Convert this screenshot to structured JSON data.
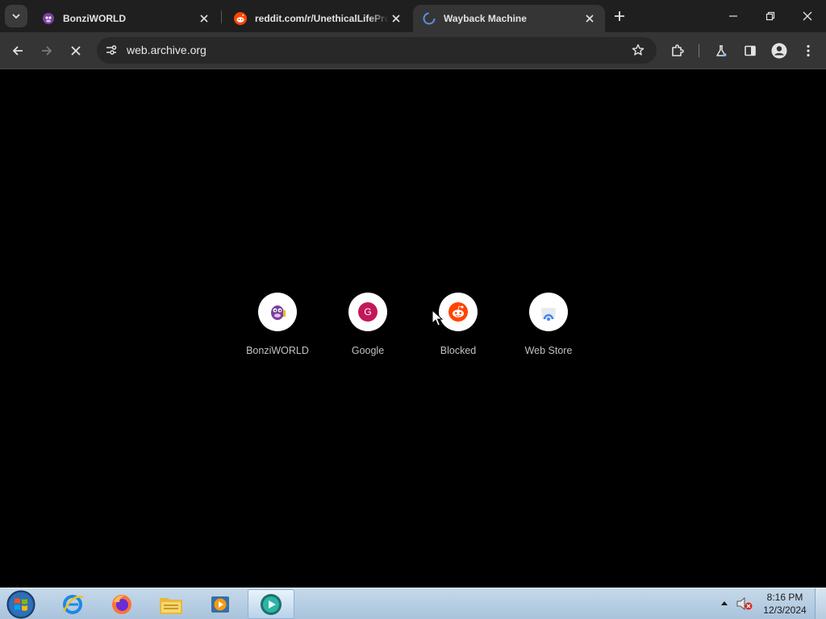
{
  "browser": {
    "tabs": [
      {
        "title": "BonziWORLD",
        "favicon": "bonzi-icon",
        "active": false
      },
      {
        "title": "reddit.com/r/UnethicalLifeProTips",
        "favicon": "reddit-icon",
        "active": false
      },
      {
        "title": "Wayback Machine",
        "favicon": "wayback-icon",
        "active": true
      }
    ],
    "address_bar": {
      "url": "web.archive.org"
    }
  },
  "new_tab_page": {
    "shortcuts": [
      {
        "label": "BonziWORLD",
        "icon": "bonzi-icon"
      },
      {
        "label": "Google",
        "icon": "google-g-icon",
        "letter": "G"
      },
      {
        "label": "Blocked",
        "icon": "reddit-icon"
      },
      {
        "label": "Web Store",
        "icon": "web-store-icon"
      }
    ]
  },
  "taskbar": {
    "apps": [
      "internet-explorer-icon",
      "firefox-icon",
      "file-explorer-icon",
      "media-player-icon",
      "active-app-icon"
    ],
    "clock": {
      "time": "8:16 PM",
      "date": "12/3/2024"
    }
  },
  "colors": {
    "tab_strip": "#1f1f1f",
    "toolbar": "#353535",
    "omnibox": "#282828",
    "page_background": "#000000",
    "reddit_orange": "#ff4500",
    "google_badge": "#c2185b",
    "taskbar": "#b8cfe4"
  }
}
